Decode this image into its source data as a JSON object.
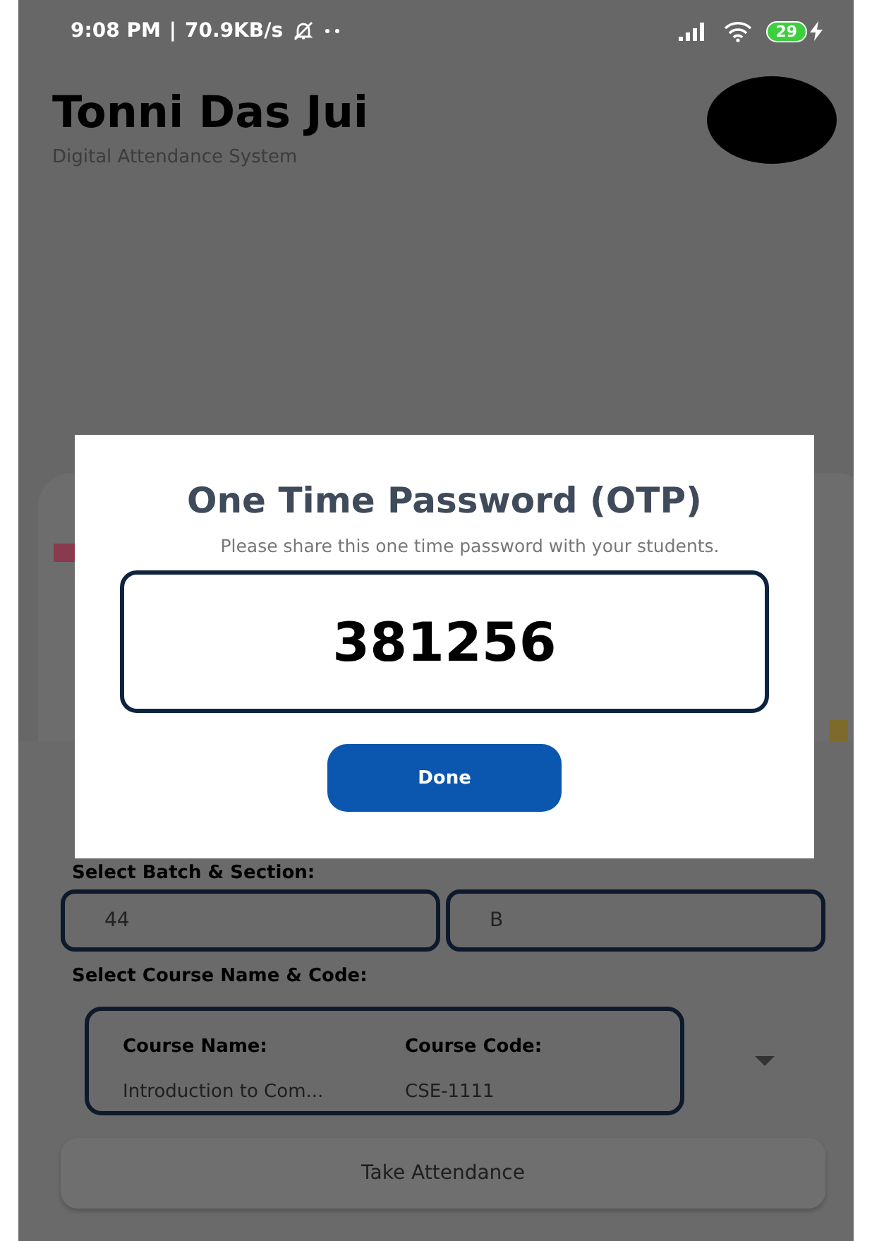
{
  "status_bar": {
    "time": "9:08 PM",
    "separator": "|",
    "speed": "70.9KB/s",
    "battery": "29"
  },
  "header": {
    "title": "Tonni Das Jui",
    "subtitle": "Digital Attendance System"
  },
  "form": {
    "batch_label": "Select Batch & Section:",
    "batch": "44",
    "section": "B",
    "course_label": "Select Course Name & Code:",
    "course": {
      "name_label": "Course Name:",
      "name": "Introduction to Com...",
      "code_label": "Course Code:",
      "code": "CSE-1111"
    },
    "submit": "Take Attendance"
  },
  "dialog": {
    "title": "One Time Password (OTP)",
    "message": "Please share this one time password with your students.",
    "otp": "381256",
    "button": "Done"
  }
}
